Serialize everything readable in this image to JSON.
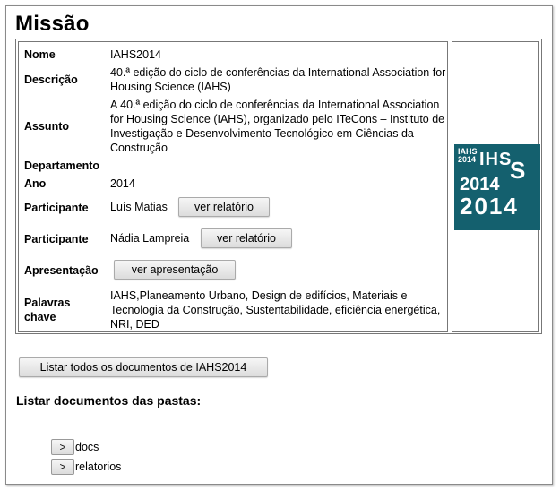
{
  "page": {
    "title": "Missão"
  },
  "details": {
    "nome_label": "Nome",
    "nome": "IAHS2014",
    "descricao_label": "Descrição",
    "descricao": "40.ª edição do ciclo de conferências da International Association for Housing Science (IAHS)",
    "assunto_label": "Assunto",
    "assunto": "A 40.ª edição do ciclo de conferências da International Association for Housing Science (IAHS), organizado pelo ITeCons – Instituto de Investigação e Desenvolvimento Tecnológico em Ciências da Construção",
    "departamento_label": "Departamento",
    "departamento": "",
    "ano_label": "Ano",
    "ano": "2014",
    "participante_label": "Participante",
    "participante1": "Luís Matias",
    "participante2": "Nádia Lampreia",
    "ver_relatorio": "ver relatório",
    "apresentacao_label": "Apresentação",
    "ver_apresentacao": "ver apresentação",
    "palavras_label": "Palavras chave",
    "palavras": "IAHS,Planeamento Urbano, Design de edifícios, Materiais e Tecnologia da Construção, Sustentabilidade, eficiência energética, NRI, DED"
  },
  "logo": {
    "small_text": "IAHS 2014",
    "top": "IHS",
    "s": "S",
    "year": "2014",
    "year2": "2014"
  },
  "listar_todos": "Listar todos os documentos de IAHS2014",
  "folders_heading": "Listar documentos das pastas:",
  "folders": [
    {
      "toggle": ">",
      "name": "docs"
    },
    {
      "toggle": ">",
      "name": "relatorios"
    }
  ],
  "colors": {
    "logo_bg": "#14606e"
  }
}
